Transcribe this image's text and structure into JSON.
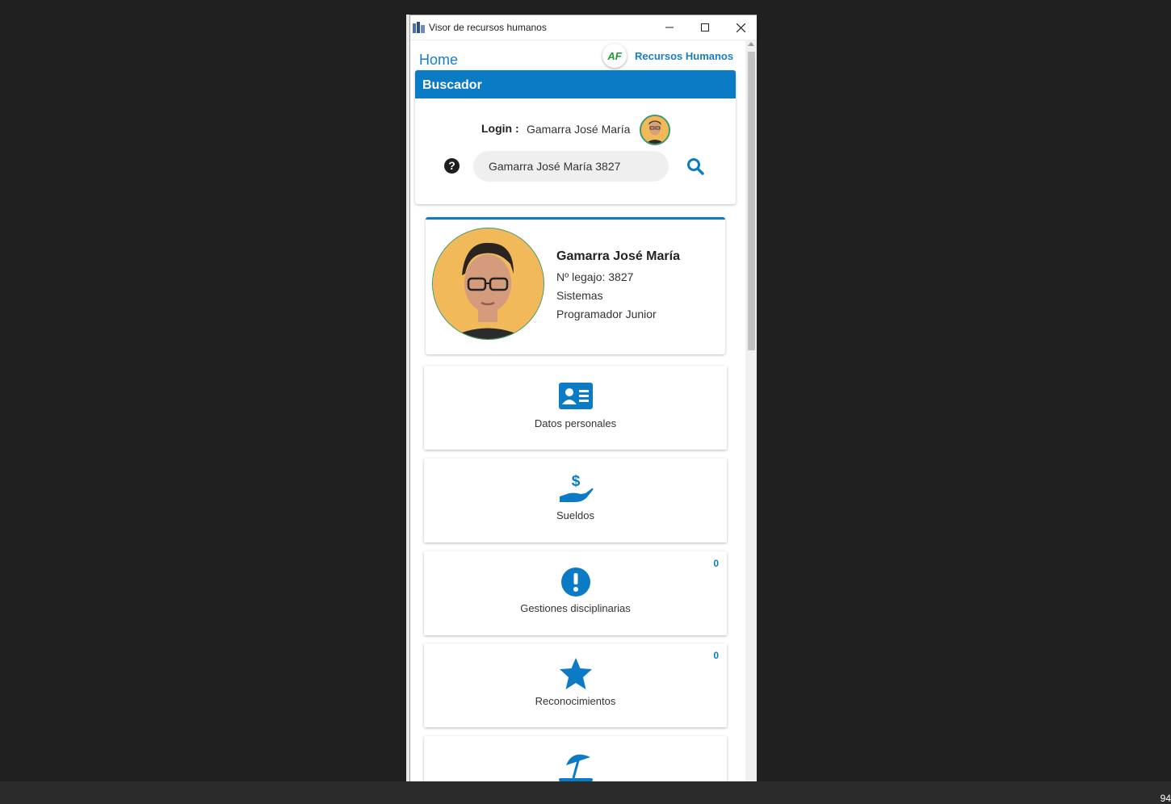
{
  "window": {
    "title": "Visor de recursos humanos",
    "minimize": "—",
    "maximize": "☐",
    "close": "✕"
  },
  "header": {
    "home_label": "Home",
    "brand_logo_text": "AF",
    "brand_name": "Recursos Humanos"
  },
  "buscador": {
    "title": "Buscador",
    "login_label": "Login :",
    "login_value": "Gamarra José María",
    "help_icon": "?",
    "search_value": "Gamarra José María 3827"
  },
  "profile": {
    "name": "Gamarra José María",
    "legajo": "Nº legajo: 3827",
    "area": "Sistemas",
    "cargo": "Programador Junior"
  },
  "menu": {
    "items": [
      {
        "label": "Datos personales",
        "icon": "id-card-icon",
        "badge": ""
      },
      {
        "label": "Sueldos",
        "icon": "hand-dollar-icon",
        "badge": ""
      },
      {
        "label": "Gestiones disciplinarias",
        "icon": "exclamation-circle-icon",
        "badge": "0"
      },
      {
        "label": "Reconocimientos",
        "icon": "star-icon",
        "badge": "0"
      },
      {
        "label": "",
        "icon": "umbrella-beach-icon",
        "badge": ""
      }
    ]
  },
  "taskbar": {
    "number": "94"
  },
  "colors": {
    "accent": "#0a7bc4",
    "brand_green": "#1d9a3a",
    "background": "#202020"
  }
}
